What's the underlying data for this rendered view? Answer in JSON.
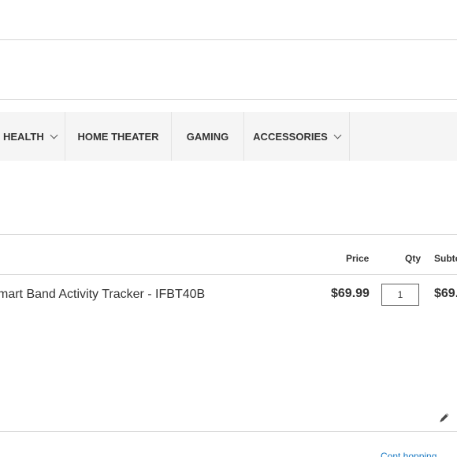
{
  "nav": {
    "items": [
      {
        "label": "HEALTH"
      },
      {
        "label": "HOME THEATER"
      },
      {
        "label": "GAMING"
      },
      {
        "label": "ACCESSORIES"
      }
    ]
  },
  "cart": {
    "headers": {
      "price": "Price",
      "qty": "Qty",
      "subtotal": "Subto"
    },
    "items": [
      {
        "name": "mart Band Activity Tracker - IFBT40B",
        "price": "$69.99",
        "qty": "1",
        "subtotal": "$69."
      }
    ],
    "edit_icon": "pencil-icon"
  },
  "footer": {
    "continue_link": "Cont hopping"
  },
  "colors": {
    "nav_background": "#f5f5f5",
    "divider": "#d6d6d6",
    "link": "#1979c3"
  }
}
